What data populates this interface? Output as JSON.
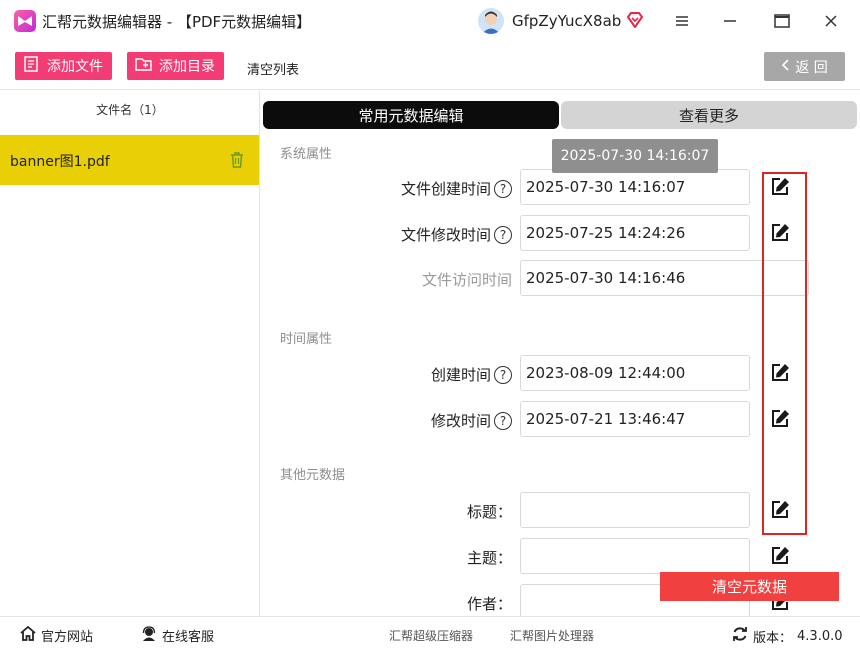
{
  "window": {
    "title": "汇帮元数据编辑器 - 【PDF元数据编辑】",
    "username": "GfpZyYucX8ab"
  },
  "toolbar": {
    "add_file": "添加文件",
    "add_folder": "添加目录",
    "clear_list": "清空列表",
    "back": "返 回"
  },
  "sidebar": {
    "header": "文件名（1）",
    "files": [
      "banner图1.pdf"
    ]
  },
  "tabs": {
    "common": "常用元数据编辑",
    "more": "查看更多"
  },
  "tooltip": "2025-07-30 14:16:07",
  "sections": {
    "system": {
      "title": "系统属性",
      "created_label": "文件创建时间",
      "created_value": "2025-07-30 14:16:07",
      "modified_label": "文件修改时间",
      "modified_value": "2025-07-25 14:24:26",
      "accessed_label": "文件访问时间",
      "accessed_value": "2025-07-30 14:16:46"
    },
    "time": {
      "title": "时间属性",
      "created_label": "创建时间",
      "created_value": "2023-08-09 12:44:00",
      "modified_label": "修改时间",
      "modified_value": "2025-07-21 13:46:47"
    },
    "other": {
      "title": "其他元数据",
      "title_label": "标题：",
      "title_value": "",
      "subject_label": "主题：",
      "subject_value": "",
      "author_label": "作者：",
      "author_value": ""
    }
  },
  "actions": {
    "clear_metadata": "清空元数据"
  },
  "statusbar": {
    "website": "官方网站",
    "support": "在线客服",
    "compressor": "汇帮超级压缩器",
    "image_tool": "汇帮图片处理器",
    "version_label": "版本：",
    "version": "4.3.0.0"
  },
  "colors": {
    "accent_pink": "#f23c73",
    "selected_file": "#e8cf06",
    "highlight_frame": "#e02424",
    "clear_button": "#f04040"
  }
}
